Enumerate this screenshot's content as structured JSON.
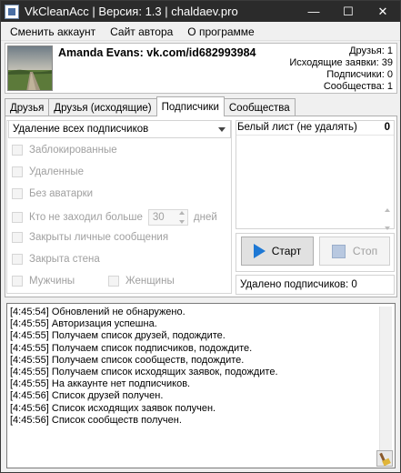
{
  "window": {
    "title": "VkCleanAcc | Версия: 1.3 | chaldaev.pro",
    "controls": {
      "minimize": "—",
      "maximize": "☐",
      "close": "✕"
    }
  },
  "menu": {
    "items": [
      {
        "label": "Сменить аккаунт"
      },
      {
        "label": "Сайт автора"
      },
      {
        "label": "О программе"
      }
    ]
  },
  "profile": {
    "name": "Amanda Evans: vk.com/id682993984",
    "stats": [
      "Друзья: 1",
      "Исходящие заявки: 39",
      "Подписчики: 0",
      "Сообщества: 1"
    ]
  },
  "tabs": [
    {
      "label": "Друзья"
    },
    {
      "label": "Друзья (исходящие)"
    },
    {
      "label": "Подписчики",
      "active": true
    },
    {
      "label": "Сообщества"
    }
  ],
  "subscribers": {
    "mode_select": "Удаление всех подписчиков",
    "options": {
      "blocked": "Заблокированные",
      "deleted": "Удаленные",
      "no_avatar": "Без аватарки",
      "not_visited": "Кто не заходил больше",
      "not_visited_days": "30",
      "days_unit": "дней",
      "closed_messages": "Закрыты личные сообщения",
      "closed_wall": "Закрыта стена",
      "men": "Мужчины",
      "women": "Женщины"
    },
    "whitelist_label": "Белый лист (не удалять)",
    "whitelist_count": "0",
    "start_label": "Старт",
    "stop_label": "Стоп",
    "deleted_status": "Удалено подписчиков: 0"
  },
  "log": [
    "[4:45:54] Обновлений не обнаружено.",
    "[4:45:55] Авторизация успешна.",
    "[4:45:55] Получаем список друзей, подождите.",
    "[4:45:55] Получаем список подписчиков, подождите.",
    "[4:45:55] Получаем список сообществ, подождите.",
    "[4:45:55] Получаем список исходящих заявок, подождите.",
    "[4:45:55] На аккаунте нет подписчиков.",
    "[4:45:56] Список друзей получен.",
    "[4:45:56] Список исходящих заявок получен.",
    "[4:45:56] Список сообществ получен."
  ],
  "icons": {
    "app": "app-icon",
    "avatar": "avatar",
    "start": "play-icon",
    "stop": "stop-icon",
    "clear_log": "broom-icon"
  }
}
